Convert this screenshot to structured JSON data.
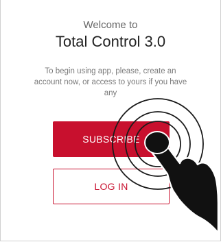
{
  "onboarding": {
    "welcome": "Welcome to",
    "app_name": "Total Control 3.0",
    "intro_line1": "To begin using app, please, create an",
    "intro_line2": "account now, or access to yours if you have",
    "intro_line3": "any"
  },
  "actions": {
    "subscribe_label": "SUBSCRIBE",
    "login_label": "LOG IN"
  },
  "colors": {
    "brand_red": "#c8102e"
  },
  "overlay": {
    "icon": "tap-hand-icon"
  }
}
